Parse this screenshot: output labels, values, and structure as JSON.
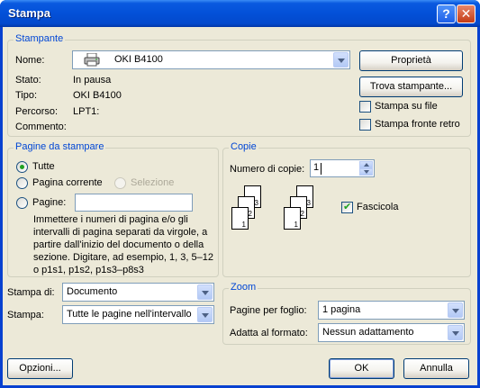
{
  "window": {
    "title": "Stampa",
    "help": "?",
    "close": "✕"
  },
  "printer": {
    "group_label": "Stampante",
    "name_label": "Nome:",
    "name_value": "OKI B4100",
    "status_label": "Stato:",
    "status_value": "In pausa",
    "type_label": "Tipo:",
    "type_value": "OKI B4100",
    "path_label": "Percorso:",
    "path_value": "LPT1:",
    "comment_label": "Commento:",
    "properties_button": "Proprietà",
    "find_button": "Trova stampante...",
    "print_to_file": {
      "label": "Stampa su file",
      "checked": false
    },
    "duplex": {
      "label": "Stampa fronte retro",
      "checked": false
    }
  },
  "pages": {
    "group_label": "Pagine da stampare",
    "all": "Tutte",
    "current": "Pagina corrente",
    "selection": "Selezione",
    "range": "Pagine:",
    "range_value": "",
    "selected": "all",
    "hint": "Immettere i numeri di pagina e/o gli intervalli di pagina separati da virgole, a partire dall'inizio del documento o della sezione. Digitare, ad esempio, 1, 3, 5–12 o p1s1, p1s2, p1s3–p8s3"
  },
  "copies": {
    "group_label": "Copie",
    "count_label": "Numero di copie:",
    "count_value": "1",
    "collate": {
      "label": "Fascicola",
      "checked": true
    },
    "stack_labels": [
      "3",
      "2",
      "1"
    ]
  },
  "print_what": {
    "label": "Stampa di:",
    "value": "Documento"
  },
  "print": {
    "label": "Stampa:",
    "value": "Tutte le pagine nell'intervallo"
  },
  "zoom": {
    "group_label": "Zoom",
    "pages_per_sheet_label": "Pagine per foglio:",
    "pages_per_sheet_value": "1 pagina",
    "scale_label": "Adatta al formato:",
    "scale_value": "Nessun adattamento"
  },
  "buttons": {
    "options": "Opzioni...",
    "ok": "OK",
    "cancel": "Annulla"
  },
  "colors": {
    "titlebar": "#0350d8",
    "dialog_bg": "#ece9d8",
    "group_label": "#0046d5",
    "check_green": "#21a121"
  }
}
